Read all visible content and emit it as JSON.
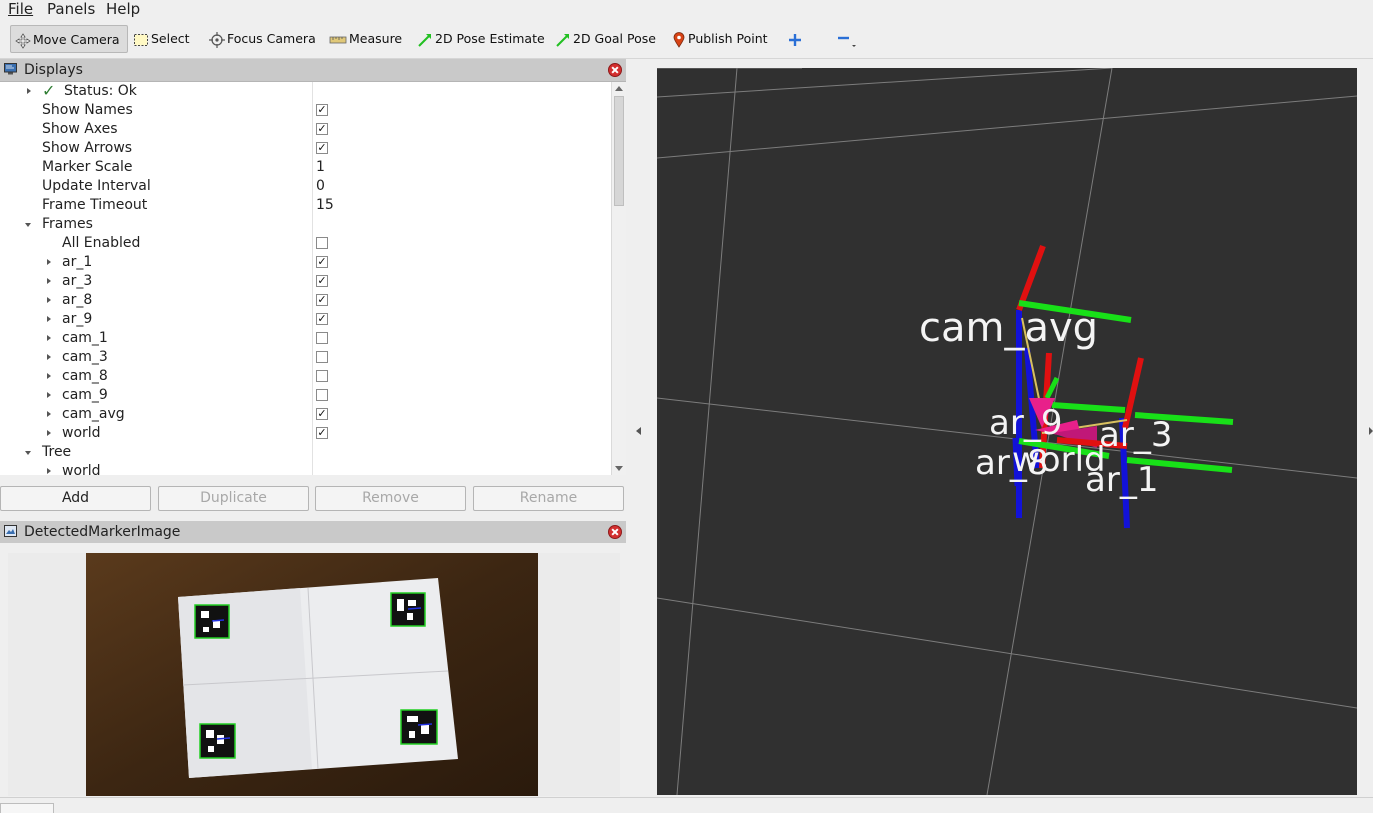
{
  "menu": [
    "File",
    "Panels",
    "Help"
  ],
  "toolbar": {
    "move_camera": "Move Camera",
    "select": "Select",
    "focus_camera": "Focus Camera",
    "measure": "Measure",
    "pose_estimate": "2D Pose Estimate",
    "goal_pose": "2D Goal Pose",
    "publish_point": "Publish Point"
  },
  "displays": {
    "title": "Displays",
    "status": "Status: Ok",
    "props": [
      {
        "label": "Show Names",
        "checked": true
      },
      {
        "label": "Show Axes",
        "checked": true
      },
      {
        "label": "Show Arrows",
        "checked": true
      },
      {
        "label": "Marker Scale",
        "value": "1"
      },
      {
        "label": "Update Interval",
        "value": "0"
      },
      {
        "label": "Frame Timeout",
        "value": "15"
      }
    ],
    "frames_label": "Frames",
    "all_enabled": "All Enabled",
    "frames": [
      {
        "label": "ar_1",
        "checked": true
      },
      {
        "label": "ar_3",
        "checked": true
      },
      {
        "label": "ar_8",
        "checked": true
      },
      {
        "label": "ar_9",
        "checked": true
      },
      {
        "label": "cam_1",
        "checked": false
      },
      {
        "label": "cam_3",
        "checked": false
      },
      {
        "label": "cam_8",
        "checked": false
      },
      {
        "label": "cam_9",
        "checked": false
      },
      {
        "label": "cam_avg",
        "checked": true
      },
      {
        "label": "world",
        "checked": true
      }
    ],
    "tree_label": "Tree",
    "tree_child": "world"
  },
  "buttons": {
    "add": "Add",
    "duplicate": "Duplicate",
    "remove": "Remove",
    "rename": "Rename"
  },
  "image_panel": {
    "title": "DetectedMarkerImage"
  },
  "viewport_labels": {
    "cam_avg": "cam_avg",
    "ar_9": "ar_9",
    "ar_3": "ar_3",
    "ar_8": "ar_8",
    "ar_1": "ar_1",
    "world": "world"
  },
  "colors": {
    "x_axis": "#e01010",
    "y_axis": "#18e018",
    "z_axis": "#1010d8",
    "arrow": "#e8208a",
    "grid": "#8a8a8a",
    "background": "#303030"
  }
}
